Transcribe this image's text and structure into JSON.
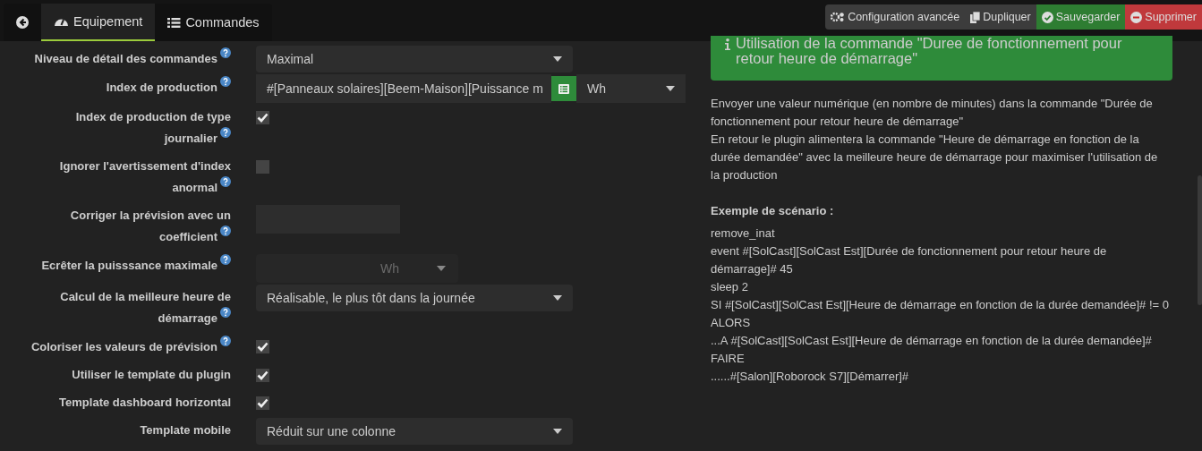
{
  "header": {
    "tabs": [
      {
        "label": "Equipement",
        "selected": true
      },
      {
        "label": "Commandes",
        "selected": false
      }
    ],
    "actions": [
      {
        "label": "Configuration avancée",
        "kind": "config"
      },
      {
        "label": "Dupliquer",
        "kind": "copy"
      },
      {
        "label": "Sauvegarder",
        "kind": "save"
      },
      {
        "label": "Supprimer",
        "kind": "delete"
      }
    ]
  },
  "form": [
    {
      "label": "Niveau de détail des commandes",
      "help": true,
      "kind": "select",
      "value": "Maximal"
    },
    {
      "label": "Index de production",
      "help": true,
      "kind": "command",
      "value": "#[Panneaux solaires][Beem-Maison][Puissance m",
      "unit": "Wh"
    },
    {
      "label": "Index de production de type journalier",
      "help": true,
      "kind": "checkbox",
      "checked": true
    },
    {
      "label": "Ignorer l'avertissement d'index anormal",
      "help": true,
      "kind": "checkbox",
      "checked": false
    },
    {
      "label": "Corriger la prévision avec un coefficient",
      "help": true,
      "kind": "input"
    },
    {
      "label": "Ecrêter la puisssance maximale",
      "help": true,
      "kind": "unit-input",
      "unit": "Wh",
      "disabled": true
    },
    {
      "label": "Calcul de la meilleure heure de démarrage",
      "help": true,
      "kind": "select",
      "value": "Réalisable, le plus tôt dans la journée"
    },
    {
      "label": "Coloriser les valeurs de prévision",
      "help": true,
      "kind": "checkbox",
      "checked": true
    },
    {
      "label": "Utiliser le template du plugin",
      "help": false,
      "kind": "checkbox",
      "checked": true
    },
    {
      "label": "Template dashboard horizontal",
      "help": false,
      "kind": "checkbox",
      "checked": true
    },
    {
      "label": "Template mobile",
      "help": false,
      "kind": "select",
      "value": "Réduit sur une colonne"
    }
  ],
  "info": {
    "alert": "Utilisation de la commande \"Duree de fonctionnement pour retour heure de démarrage\"",
    "paragraphs": [
      "Envoyer une valeur numérique (en nombre de minutes) dans la commande \"Durée de fonctionnement pour retour heure de démarrage\"",
      "En retour le plugin alimentera la commande \"Heure de démarrage en fonction de la durée demandée\" avec la meilleure heure de démarrage pour maximiser l'utilisation de la production"
    ],
    "example_title": "Exemple de scénario :",
    "example_lines": [
      "remove_inat",
      "event #[SolCast][SolCast Est][Durée de fonctionnement pour retour heure de démarrage]# 45",
      "sleep 2",
      "SI #[SolCast][SolCast Est][Heure de démarrage en fonction de la durée demandée]# != 0 ALORS",
      "...A #[SolCast][SolCast Est][Heure de démarrage en fonction de la durée demandée]# FAIRE",
      "......#[Salon][Roborock S7][Démarrer]#"
    ]
  }
}
